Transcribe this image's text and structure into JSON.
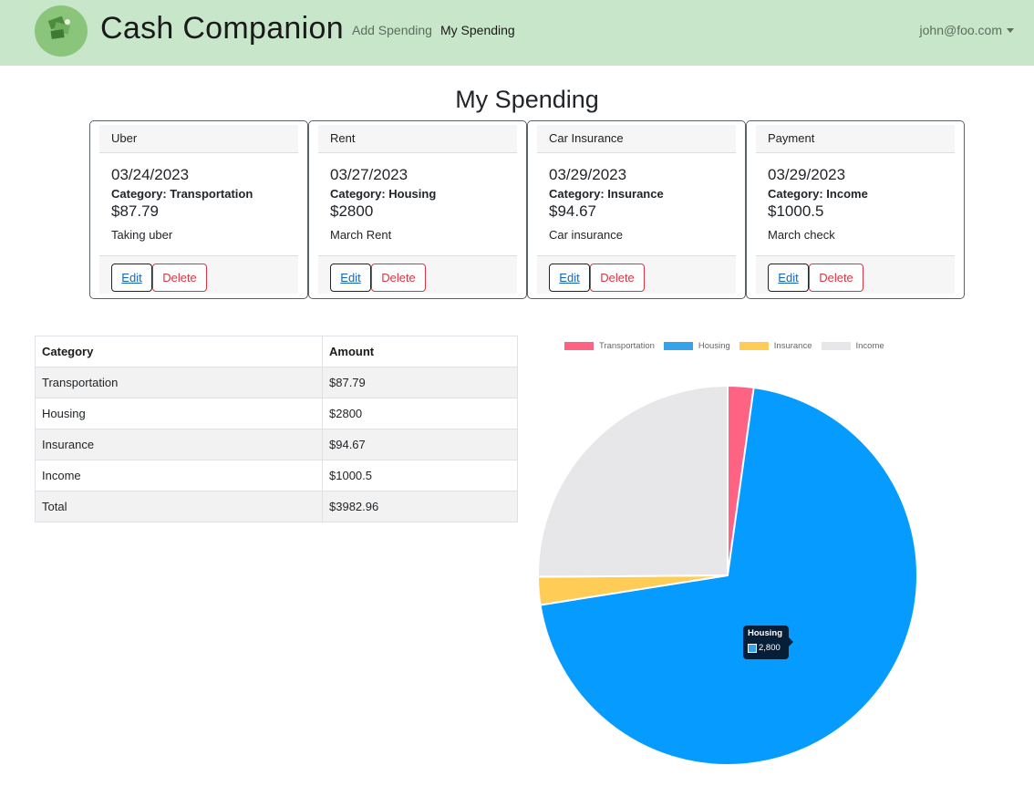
{
  "nav": {
    "brand": "Cash Companion",
    "links": [
      "Add Spending",
      "My Spending"
    ],
    "user": "john@foo.com"
  },
  "page_title": "My Spending",
  "cards": [
    {
      "title": "Uber",
      "date": "03/24/2023",
      "category": "Category: Transportation",
      "amount": "$87.79",
      "description": "Taking uber",
      "edit_label": "Edit",
      "delete_label": "Delete"
    },
    {
      "title": "Rent",
      "date": "03/27/2023",
      "category": "Category: Housing",
      "amount": "$2800",
      "description": "March Rent",
      "edit_label": "Edit",
      "delete_label": "Delete"
    },
    {
      "title": "Car Insurance",
      "date": "03/29/2023",
      "category": "Category: Insurance",
      "amount": "$94.67",
      "description": "Car insurance",
      "edit_label": "Edit",
      "delete_label": "Delete"
    },
    {
      "title": "Payment",
      "date": "03/29/2023",
      "category": "Category: Income",
      "amount": "$1000.5",
      "description": "March check",
      "edit_label": "Edit",
      "delete_label": "Delete"
    }
  ],
  "table": {
    "headers": [
      "Category",
      "Amount"
    ],
    "rows": [
      [
        "Transportation",
        "$87.79"
      ],
      [
        "Housing",
        "$2800"
      ],
      [
        "Insurance",
        "$94.67"
      ],
      [
        "Income",
        "$1000.5"
      ],
      [
        "Total",
        "$3982.96"
      ]
    ]
  },
  "chart_data": {
    "type": "pie",
    "categories": [
      "Transportation",
      "Housing",
      "Insurance",
      "Income"
    ],
    "values": [
      87.79,
      2800,
      94.67,
      1000.5
    ],
    "colors": [
      "#ff6384",
      "#36a2eb",
      "#ffcd56",
      "#e7e7ea"
    ],
    "legend": "top",
    "tooltip": {
      "label": "Housing",
      "value": "2,800"
    }
  },
  "icons": {
    "logo": "cash-companion-logo",
    "caret": "caret-down-icon"
  }
}
